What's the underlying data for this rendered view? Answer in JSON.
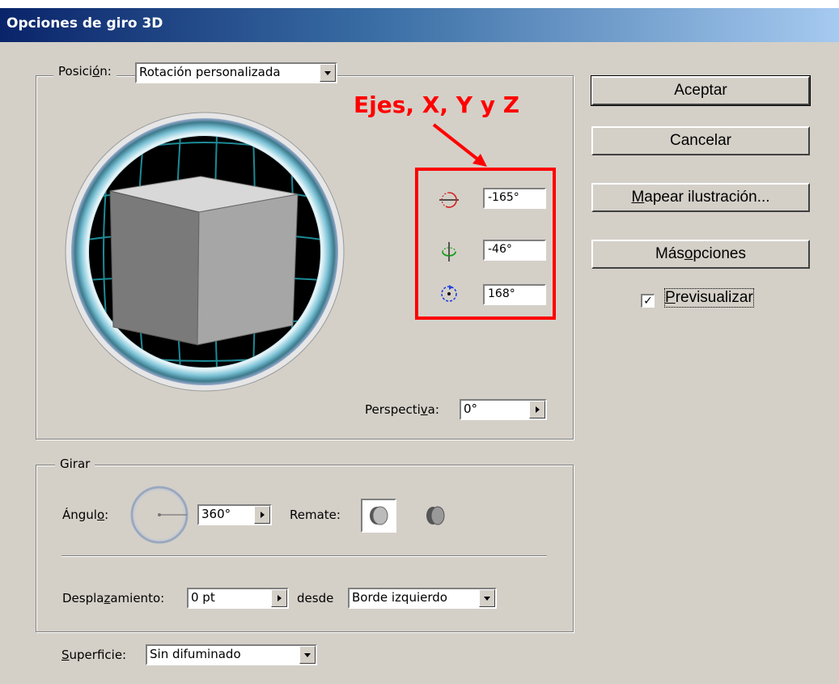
{
  "window": {
    "title": "Opciones de giro 3D"
  },
  "position": {
    "label_pre": "Posici",
    "label_u": "ó",
    "label_post": "n:",
    "selected": "Rotación personalizada"
  },
  "annotation": {
    "text": "Ejes, X, Y y Z",
    "color": "#ff0000"
  },
  "axes": [
    {
      "icon": "x-axis-rotation-icon",
      "value": "-165°",
      "color": "#d42020"
    },
    {
      "icon": "y-axis-rotation-icon",
      "value": "-46°",
      "color": "#1a9a1a"
    },
    {
      "icon": "z-axis-rotation-icon",
      "value": "168°",
      "color": "#2040e0"
    }
  ],
  "perspective": {
    "label_pre": "Perspecti",
    "label_u": "v",
    "label_post": "a:",
    "value": "0°"
  },
  "buttons": {
    "accept": "Aceptar",
    "cancel": "Cancelar",
    "map_pre": "",
    "map_u": "M",
    "map_post": "apear ilustración...",
    "more_pre": "Más ",
    "more_u": "o",
    "more_post": "pciones"
  },
  "preview": {
    "u": "P",
    "rest": "revisualizar",
    "checked": true,
    "check_mark": "✓"
  },
  "revolve": {
    "group_label": "Girar",
    "angle_label_pre": "Ángul",
    "angle_label_u": "o",
    "angle_label_post": ":",
    "angle_value": "360°",
    "cap_label": "Remate:",
    "offset_label_pre": "Despla",
    "offset_label_u": "z",
    "offset_label_post": "amiento:",
    "offset_value": "0 pt",
    "from_label": "desde",
    "from_value": "Borde izquierdo"
  },
  "surface": {
    "label_u": "S",
    "label_post": "uperficie:",
    "value": "Sin difuminado"
  }
}
